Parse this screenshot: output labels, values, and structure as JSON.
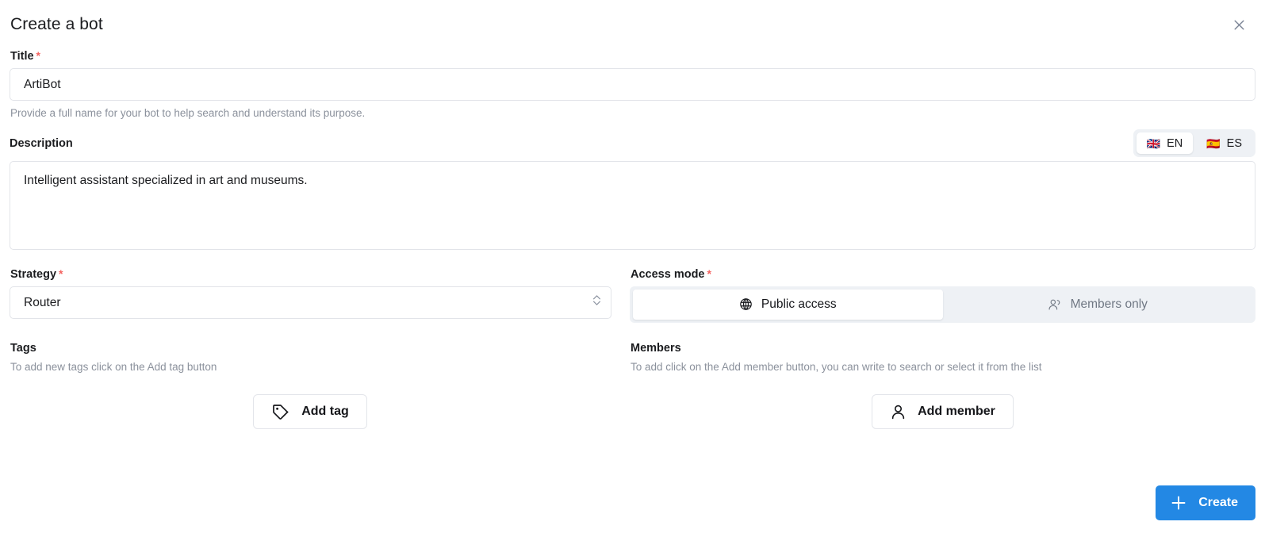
{
  "dialog": {
    "title": "Create a bot",
    "close_icon": "close-icon"
  },
  "title_field": {
    "label": "Title",
    "required_marker": "*",
    "value": "ArtiBot",
    "placeholder": "Title",
    "hint": "Provide a full name for your bot to help search and understand its purpose."
  },
  "description_field": {
    "label": "Description",
    "value": "Intelligent assistant specialized in art and museums.",
    "placeholder": "Description",
    "languages": [
      {
        "code": "EN",
        "flag": "🇬🇧",
        "flag_icon": "uk-flag-icon",
        "active": true
      },
      {
        "code": "ES",
        "flag": "🇪🇸",
        "flag_icon": "spain-flag-icon",
        "active": false
      }
    ]
  },
  "strategy_field": {
    "label": "Strategy",
    "required_marker": "*",
    "value": "Router",
    "options": [
      "Router"
    ],
    "chevron_icon": "chevron-updown-icon"
  },
  "access_mode_field": {
    "label": "Access mode",
    "required_marker": "*",
    "options": [
      {
        "label": "Public access",
        "icon": "globe-icon",
        "active": true
      },
      {
        "label": "Members only",
        "icon": "people-icon",
        "active": false
      }
    ]
  },
  "tags_section": {
    "label": "Tags",
    "hint": "To add new tags click on the Add tag button",
    "button_label": "Add tag",
    "button_icon": "tag-icon"
  },
  "members_section": {
    "label": "Members",
    "hint": "To add click on the Add member button, you can write to search or select it from the list",
    "button_label": "Add member",
    "button_icon": "person-icon"
  },
  "footer": {
    "create_label": "Create",
    "create_icon": "plus-icon"
  },
  "colors": {
    "primary": "#2388e4",
    "required": "#f4625f",
    "segment_track": "#eef1f5",
    "border": "#e2e4e9",
    "hint_text": "#8b919c"
  }
}
